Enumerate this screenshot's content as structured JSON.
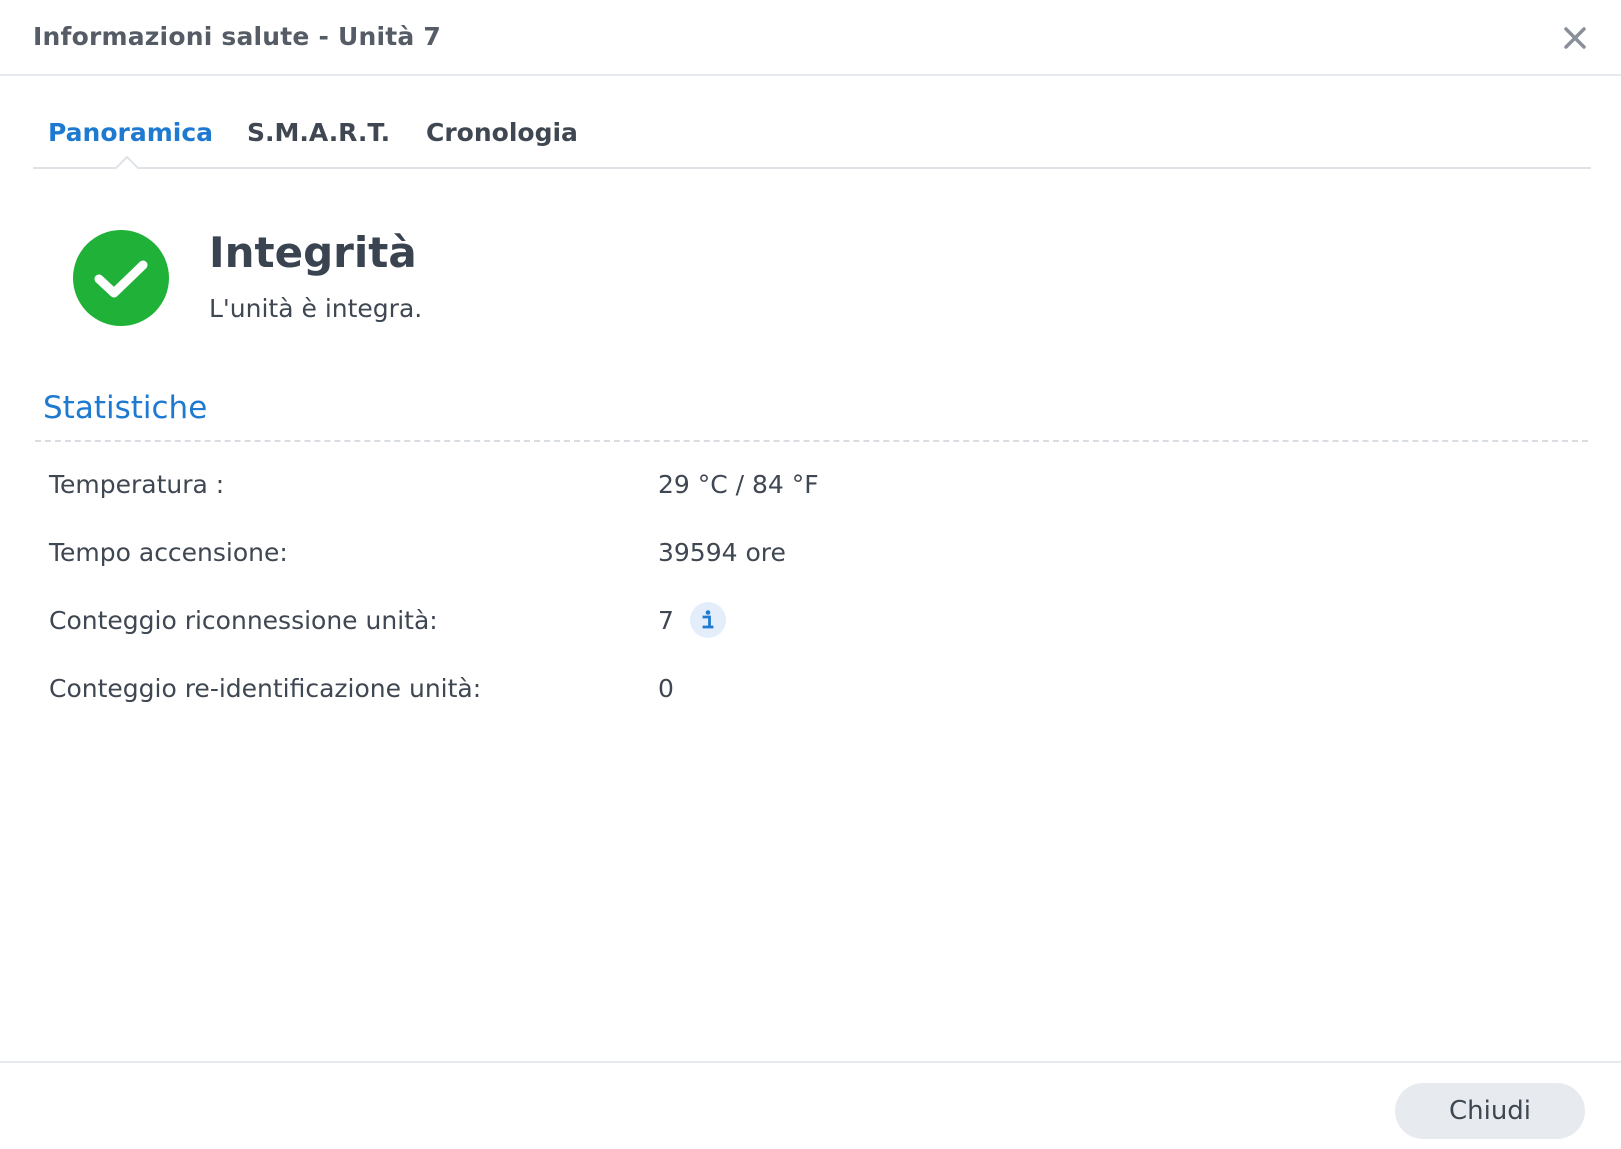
{
  "window": {
    "title": "Informazioni salute - Unità 7"
  },
  "tabs": [
    {
      "label": "Panoramica",
      "active": true
    },
    {
      "label": "S.M.A.R.T.",
      "active": false
    },
    {
      "label": "Cronologia",
      "active": false
    }
  ],
  "status": {
    "icon": "check-circle-icon",
    "title": "Integrità",
    "description": "L'unità è integra.",
    "color": "#20b138"
  },
  "statistics": {
    "title": "Statistiche",
    "rows": [
      {
        "label": "Temperatura :",
        "value": "29 °C / 84 °F"
      },
      {
        "label": "Tempo accensione:",
        "value": "39594 ore"
      },
      {
        "label": "Conteggio riconnessione unità:",
        "value": "7",
        "icon": "info-icon"
      },
      {
        "label": "Conteggio re-identificazione unità:",
        "value": "0"
      }
    ]
  },
  "footer": {
    "close_label": "Chiudi"
  },
  "colors": {
    "accent": "#1e7ad0",
    "success": "#20b138"
  }
}
